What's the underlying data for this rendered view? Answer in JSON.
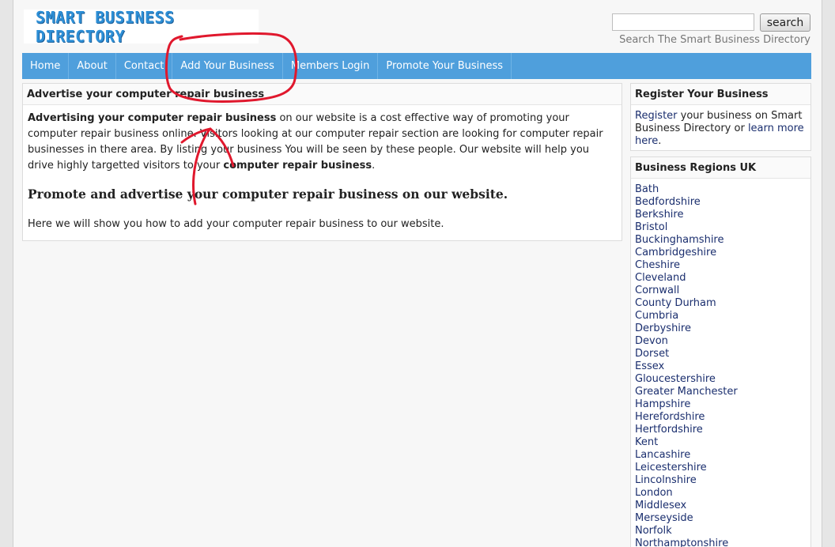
{
  "header": {
    "logo_text": "SMART BUSINESS DIRECTORY",
    "search_button": "search",
    "search_caption": "Search The Smart Business Directory",
    "search_value": ""
  },
  "nav": {
    "items": [
      "Home",
      "About",
      "Contact",
      "Add Your Business",
      "Members Login",
      "Promote Your Business"
    ]
  },
  "main": {
    "heading": "Advertise your computer repair business",
    "intro_bold": "Advertising your computer repair business",
    "intro_text": " on our website is a cost effective way of promoting your computer repair business online. Visitors looking at our computer repair section are looking for computer repair businesses in there area. By listing your business You will be seen by these people. Our website will help you drive highly targetted visitors to your ",
    "intro_bold_end": "computer repair business",
    "intro_end": ".",
    "subheading": "Promote and advertise your computer repair business on our website.",
    "footer_text": "Here we will show you how to add your computer repair business to our website."
  },
  "register": {
    "heading": "Register Your Business",
    "link_register": "Register",
    "text_middle": " your business on Smart Business Directory or ",
    "link_learn": "learn more here",
    "text_end": "."
  },
  "regions": {
    "heading": "Business Regions UK",
    "items": [
      "Bath",
      "Bedfordshire",
      "Berkshire",
      "Bristol",
      "Buckinghamshire",
      "Cambridgeshire",
      "Cheshire",
      "Cleveland",
      "Cornwall",
      "County Durham",
      "Cumbria",
      "Derbyshire",
      "Devon",
      "Dorset",
      "Essex",
      "Gloucestershire",
      "Greater Manchester",
      "Hampshire",
      "Herefordshire",
      "Hertfordshire",
      "Kent",
      "Lancashire",
      "Leicestershire",
      "Lincolnshire",
      "London",
      "Middlesex",
      "Merseyside",
      "Norfolk",
      "Northamptonshire"
    ]
  },
  "colors": {
    "nav_bg": "#4f9fdc",
    "link": "#1a2e6e",
    "annotation": "#e0182d",
    "logo": "#2d8fd6"
  }
}
